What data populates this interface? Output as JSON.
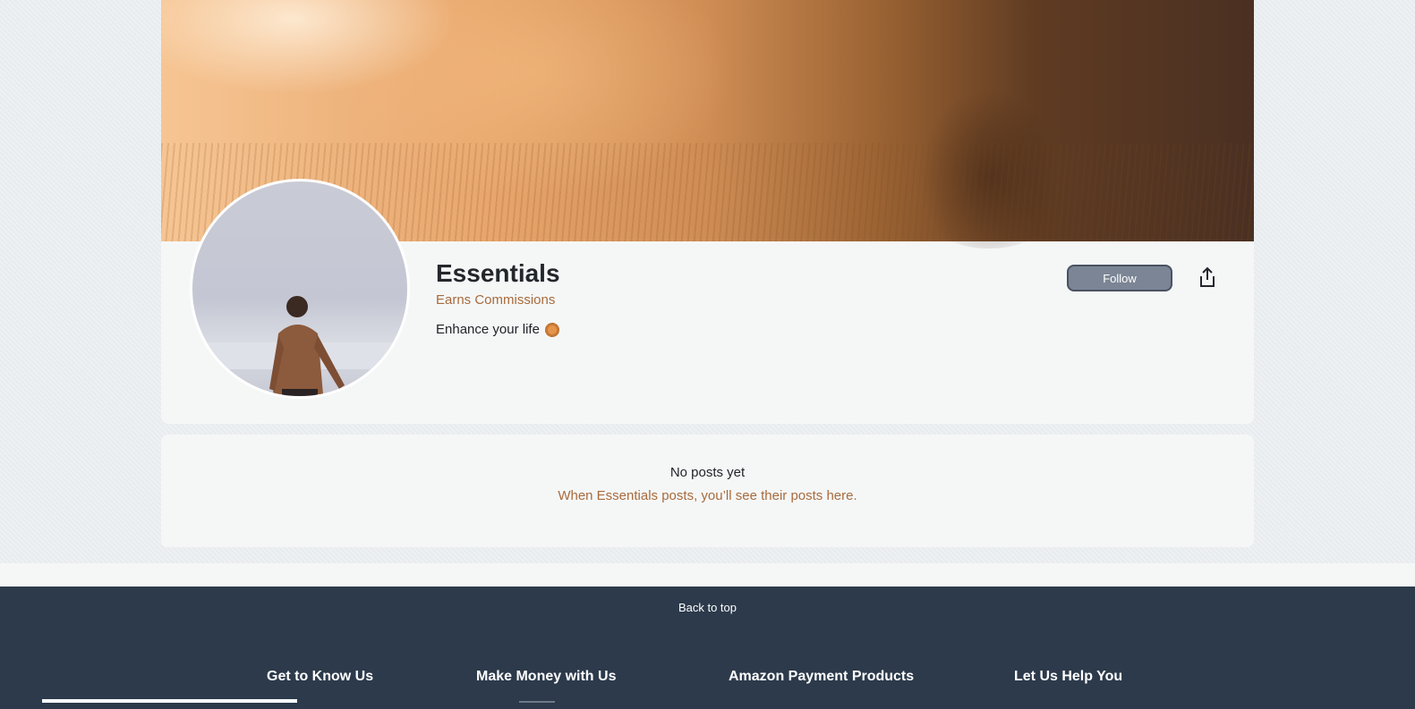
{
  "profile": {
    "name": "Essentials",
    "earns": "Earns Commissions",
    "bio": "Enhance your life",
    "follow_label": "Follow"
  },
  "posts": {
    "title": "No posts yet",
    "subtitle": "When Essentials posts, you’ll see their posts here."
  },
  "footer": {
    "back_to_top": "Back to top",
    "columns": [
      "Get to Know Us",
      "Make Money with Us",
      "Amazon Payment Products",
      "Let Us Help You"
    ]
  },
  "icons": {
    "share": "share-icon",
    "bio_emoji": "sun-icon"
  },
  "colors": {
    "accent_text": "#a86b3c",
    "footer_bg": "#2c3a4b",
    "follow_bg": "#7b8595"
  }
}
